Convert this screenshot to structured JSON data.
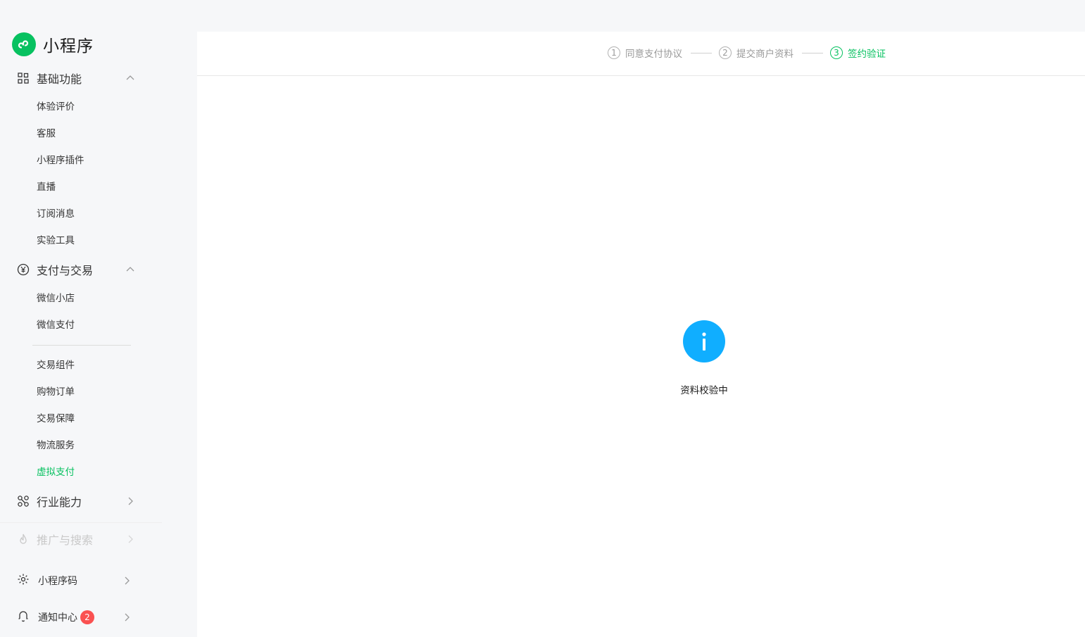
{
  "brand": {
    "name": "小程序",
    "logo_icon": "mini-program-logo-icon",
    "accent": "#07c160"
  },
  "sidebar": {
    "groups": [
      {
        "label": "基础功能",
        "icon": "grid-icon",
        "expanded": true,
        "items": [
          "体验评价",
          "客服",
          "小程序插件",
          "直播",
          "订阅消息",
          "实验工具"
        ]
      },
      {
        "label": "支付与交易",
        "icon": "yen-circle-icon",
        "expanded": true,
        "items_top": [
          "微信小店",
          "微信支付"
        ],
        "items_bottom": [
          "交易组件",
          "购物订单",
          "交易保障",
          "物流服务",
          "虚拟支付"
        ],
        "active_item": "虚拟支付"
      },
      {
        "label": "行业能力",
        "icon": "nodes-icon",
        "expanded": false
      },
      {
        "label": "推广与搜索",
        "icon": "flame-icon",
        "expanded": false,
        "disabled": true
      }
    ],
    "bottom": [
      {
        "label": "小程序码",
        "icon": "sun-code-icon"
      },
      {
        "label": "通知中心",
        "icon": "bell-icon",
        "badge": "2"
      }
    ]
  },
  "steps": [
    {
      "num": "1",
      "label": "同意支付协议",
      "active": false
    },
    {
      "num": "2",
      "label": "提交商户资料",
      "active": false
    },
    {
      "num": "3",
      "label": "签约验证",
      "active": true
    }
  ],
  "status": {
    "icon": "info-icon",
    "text": "资料校验中",
    "color": "#10aeff"
  },
  "colors": {
    "active": "#07c160",
    "badge": "#fa5151"
  }
}
